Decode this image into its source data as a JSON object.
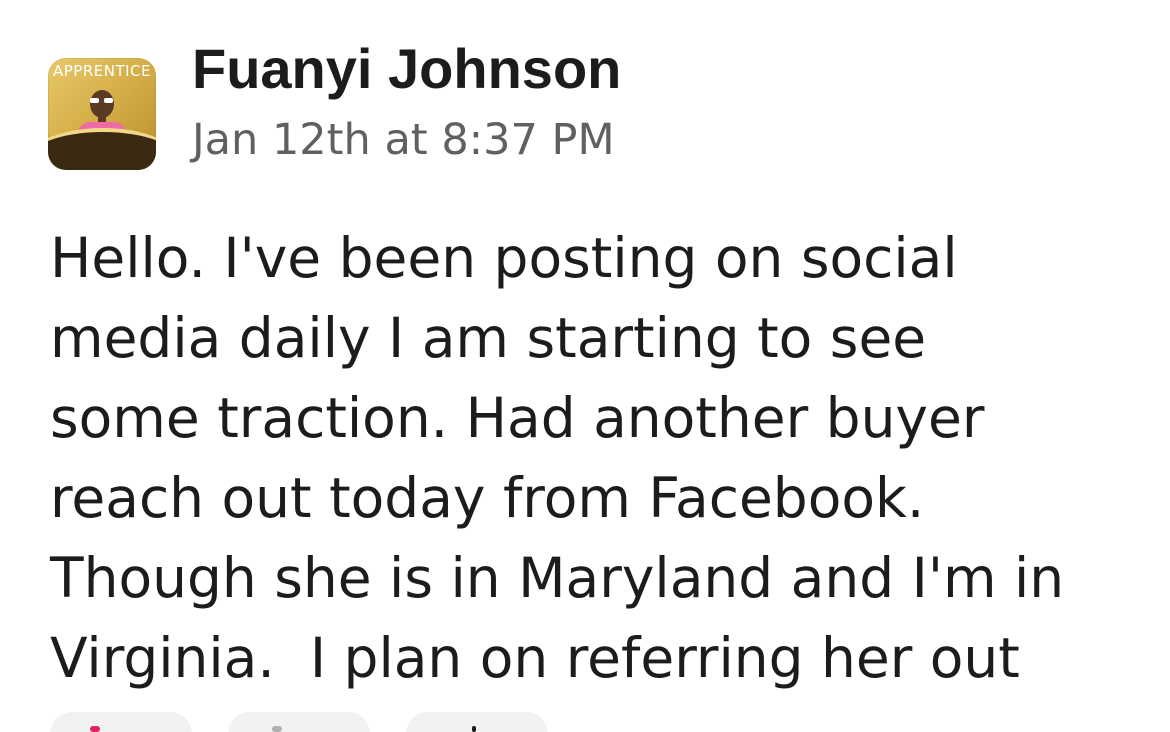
{
  "message": {
    "avatar": {
      "banner_text": "APPRENTICE"
    },
    "sender_name": "Fuanyi Johnson",
    "timestamp": "Jan 12th at 8:37 PM",
    "body_lines": [
      "Hello. I've been posting on social",
      "media daily I am starting to see",
      "some traction. Had another buyer",
      "reach out today from Facebook.",
      "Though she is in Maryland and I'm in",
      "Virginia.  I plan on referring her out"
    ]
  },
  "colors": {
    "text": "#1d1c1d",
    "timestamp": "#616061",
    "avatar_gold": "#d6b04a",
    "avatar_shirt": "#f06aa8"
  }
}
